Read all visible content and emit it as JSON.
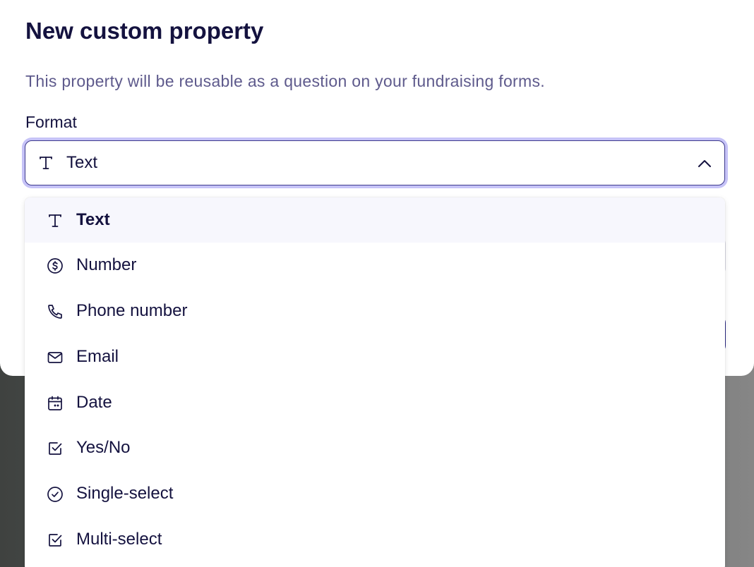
{
  "modal": {
    "title": "New custom property",
    "description": "This property will be reusable as a question on your fundraising forms."
  },
  "format": {
    "label": "Format",
    "selected": {
      "label": "Text",
      "icon": "text-icon"
    },
    "options": [
      {
        "label": "Text",
        "icon": "text-icon",
        "selected": true
      },
      {
        "label": "Number",
        "icon": "dollar-circle-icon",
        "selected": false
      },
      {
        "label": "Phone number",
        "icon": "phone-icon",
        "selected": false
      },
      {
        "label": "Email",
        "icon": "mail-icon",
        "selected": false
      },
      {
        "label": "Date",
        "icon": "calendar-icon",
        "selected": false
      },
      {
        "label": "Yes/No",
        "icon": "checkbox-icon",
        "selected": false
      },
      {
        "label": "Single-select",
        "icon": "check-circle-icon",
        "selected": false
      },
      {
        "label": "Multi-select",
        "icon": "checkbox-icon",
        "selected": false
      }
    ]
  },
  "colors": {
    "text_primary": "#14123f",
    "text_secondary": "#5e5a8c",
    "focus_ring": "#c6c3f7",
    "accent": "#2c2a86",
    "selected_bg": "#f7f7fd"
  }
}
